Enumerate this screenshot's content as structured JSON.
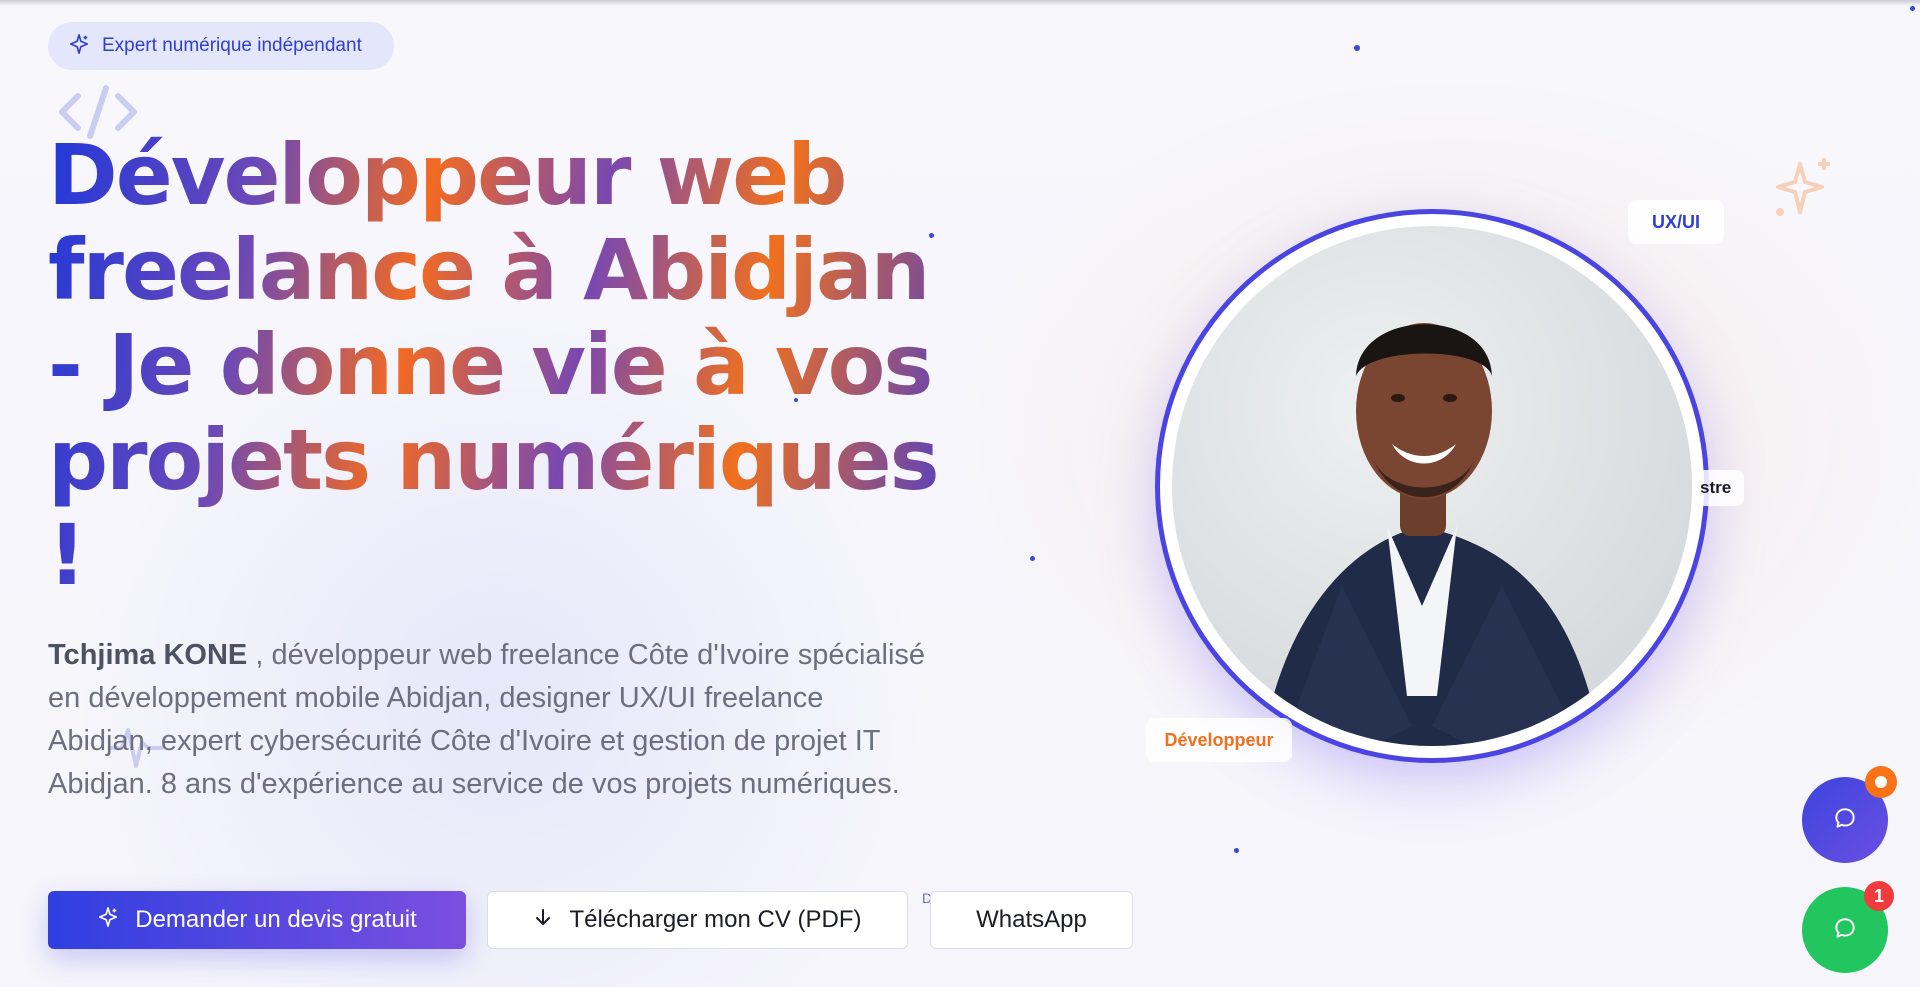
{
  "hero": {
    "badge_label": "Expert numérique indépendant",
    "title": "Développeur web freelance à Abidjan - Je donne vie à vos projets numériques !",
    "intro_name": "Tchjima KONE",
    "intro_text": " , développeur web freelance Côte d'Ivoire spécialisé en développement mobile Abidjan, designer UX/UI freelance Abidjan, expert cybersécurité Côte d'Ivoire et gestion de projet IT Abidjan. 8 ans d'expérience au service de vos projets numériques."
  },
  "buttons": {
    "quote": "Demander un devis gratuit",
    "cv": "Télécharger mon CV (PDF)",
    "whatsapp": "WhatsApp",
    "overlap_letter": "D"
  },
  "portrait": {
    "chip_ux": "UX/UI",
    "chip_dev": "Développeur",
    "chip_partial": "stre"
  },
  "floating": {
    "whatsapp_unread": "1"
  },
  "colors": {
    "primary": "#2f3fe0",
    "accent_orange": "#f0701e",
    "whatsapp_green": "#22c55e",
    "notification_red": "#ef3b3b"
  },
  "icons": [
    "sparkle-icon",
    "code-icon",
    "pulse-icon",
    "arrow-down-icon",
    "chat-icon",
    "whatsapp-icon"
  ]
}
